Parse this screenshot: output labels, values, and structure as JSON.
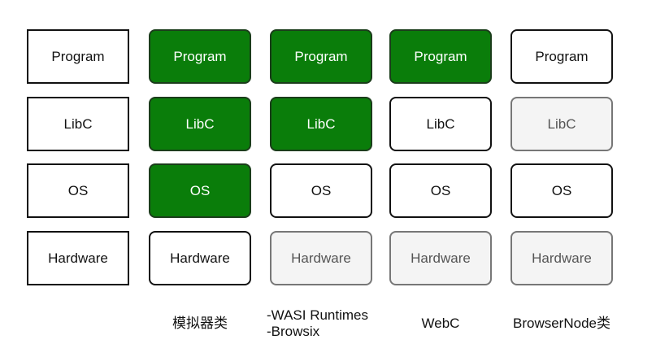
{
  "colors": {
    "green": "#0a7d0a",
    "white": "#ffffff",
    "grey": "#f4f4f4",
    "border": "#111111"
  },
  "layers": [
    "Program",
    "LibC",
    "OS",
    "Hardware"
  ],
  "columns": [
    {
      "id": "baseline",
      "label_lines": [],
      "cells": [
        {
          "text": "Program",
          "style": "white"
        },
        {
          "text": "LibC",
          "style": "white"
        },
        {
          "text": "OS",
          "style": "white"
        },
        {
          "text": "Hardware",
          "style": "white"
        }
      ]
    },
    {
      "id": "emulator",
      "label_lines": [
        "模拟器类"
      ],
      "cells": [
        {
          "text": "Program",
          "style": "green"
        },
        {
          "text": "LibC",
          "style": "green"
        },
        {
          "text": "OS",
          "style": "green"
        },
        {
          "text": "Hardware",
          "style": "white"
        }
      ]
    },
    {
      "id": "wasi",
      "label_lines": [
        "-WASI Runtimes",
        "-Browsix"
      ],
      "cells": [
        {
          "text": "Program",
          "style": "green"
        },
        {
          "text": "LibC",
          "style": "green"
        },
        {
          "text": "OS",
          "style": "white"
        },
        {
          "text": "Hardware",
          "style": "grey"
        }
      ]
    },
    {
      "id": "webc",
      "label_lines": [
        "WebC"
      ],
      "cells": [
        {
          "text": "Program",
          "style": "green"
        },
        {
          "text": "LibC",
          "style": "white"
        },
        {
          "text": "OS",
          "style": "white"
        },
        {
          "text": "Hardware",
          "style": "grey"
        }
      ]
    },
    {
      "id": "browsernode",
      "label_lines": [
        "BrowserNode类"
      ],
      "cells": [
        {
          "text": "Program",
          "style": "white"
        },
        {
          "text": "LibC",
          "style": "grey"
        },
        {
          "text": "OS",
          "style": "white"
        },
        {
          "text": "Hardware",
          "style": "grey"
        }
      ]
    }
  ]
}
